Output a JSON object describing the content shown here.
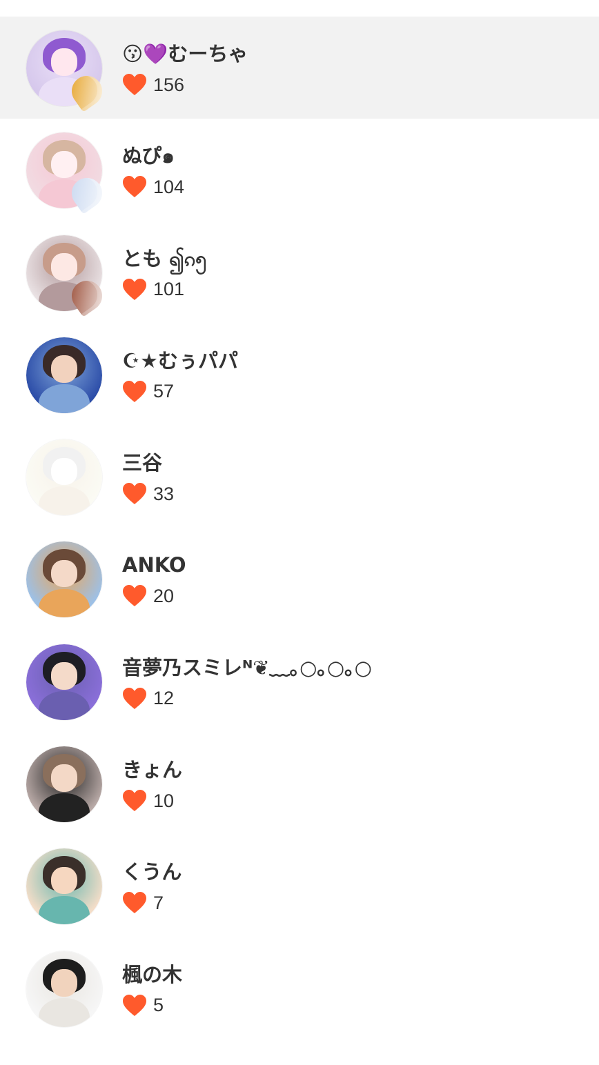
{
  "colors": {
    "heart": "#ff5a2c",
    "highlight_row": "#f2f2f2",
    "text": "#333333",
    "background": "#ffffff"
  },
  "icons": {
    "like": "heart-icon"
  },
  "users": [
    {
      "name": "😗💜むーちゃ",
      "likes": "156",
      "avatar_colors": [
        "#d6c8ec",
        "#8f5ad0",
        "#ffe7ee",
        "#eadff7"
      ],
      "badge": "#e6a42c"
    },
    {
      "name": "ぬぴ๑",
      "likes": "104",
      "avatar_colors": [
        "#f2dbe2",
        "#d6b6a1",
        "#fff0f2",
        "#f5c8d4"
      ],
      "badge": "#c9d8f0"
    },
    {
      "name": "とも ၍ၵ၅",
      "likes": "101",
      "avatar_colors": [
        "#e9e1e3",
        "#c79c8a",
        "#fde8e4",
        "#b39a9c"
      ],
      "badge": "#9a4e38"
    },
    {
      "name": "☪★むぅパパ",
      "likes": "57",
      "avatar_colors": [
        "#2c4da8",
        "#3a2a28",
        "#f2d2be",
        "#7fa4d8"
      ],
      "badge": ""
    },
    {
      "name": "三谷",
      "likes": "33",
      "avatar_colors": [
        "#fbfbf4",
        "#f1f1f1",
        "#ffffff",
        "#f7f2ea"
      ],
      "badge": ""
    },
    {
      "name": "ANKO",
      "likes": "20",
      "avatar_colors": [
        "#9dc0e6",
        "#6a4a38",
        "#f4d9c8",
        "#e9a55a"
      ],
      "badge": ""
    },
    {
      "name": "音夢乃スミレᴺ❦﹏｡○｡○｡○",
      "likes": "12",
      "avatar_colors": [
        "#8a6fd9",
        "#1e1e24",
        "#f4dac9",
        "#6a5fb0"
      ],
      "badge": ""
    },
    {
      "name": "きょん",
      "likes": "10",
      "avatar_colors": [
        "#b8a9a6",
        "#8a6f5c",
        "#f3d8c6",
        "#222222"
      ],
      "badge": ""
    },
    {
      "name": "くうん",
      "likes": "7",
      "avatar_colors": [
        "#f3ddc8",
        "#3a2f2a",
        "#f6d7c0",
        "#67b6ae"
      ],
      "badge": ""
    },
    {
      "name": "楓の木",
      "likes": "5",
      "avatar_colors": [
        "#f6f6f6",
        "#1d1d1d",
        "#f1d3bd",
        "#e9e6e1"
      ],
      "badge": ""
    }
  ]
}
